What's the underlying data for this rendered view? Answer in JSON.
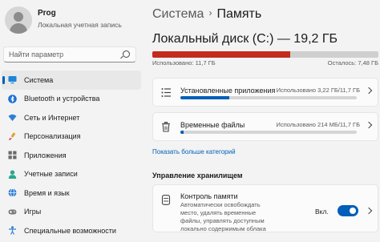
{
  "profile": {
    "name": "Prog",
    "account_type": "Локальная учетная запись"
  },
  "search": {
    "placeholder": "Найти параметр"
  },
  "sidebar": {
    "items": [
      {
        "label": "Система",
        "icon": "monitor-icon",
        "active": true
      },
      {
        "label": "Bluetooth и устройства",
        "icon": "bluetooth-icon"
      },
      {
        "label": "Сеть и Интернет",
        "icon": "wifi-icon"
      },
      {
        "label": "Персонализация",
        "icon": "brush-icon"
      },
      {
        "label": "Приложения",
        "icon": "apps-icon"
      },
      {
        "label": "Учетные записи",
        "icon": "person-icon"
      },
      {
        "label": "Время и язык",
        "icon": "globe-clock-icon"
      },
      {
        "label": "Игры",
        "icon": "gamepad-icon"
      },
      {
        "label": "Специальные возможности",
        "icon": "accessibility-icon"
      }
    ]
  },
  "header": {
    "root": "Система",
    "separator": "›",
    "current": "Память"
  },
  "disk": {
    "title": "Локальный диск (C:) — 19,2 ГБ",
    "used_label": "Использовано: 11,7 ГБ",
    "free_label": "Осталось: 7,48 ГБ",
    "used_fraction": 0.61,
    "bar_color": "#c42b1c"
  },
  "categories": [
    {
      "title": "Установленные приложения",
      "value": "Использовано 3,22 ГБ/11,7 ГБ",
      "fraction": 0.275,
      "icon": "list-icon"
    },
    {
      "title": "Временные файлы",
      "value": "Использовано 214 МБ/11,7 ГБ",
      "fraction": 0.018,
      "icon": "trash-icon"
    }
  ],
  "show_more": "Показать больше категорий",
  "storage_management": {
    "title": "Управление хранилищем",
    "sense": {
      "title": "Контроль памяти",
      "description": "Автоматически освобождать место, удалять временные файлы, управлять доступным локально содержимым облака",
      "toggle_label": "Вкл.",
      "enabled": true
    }
  },
  "accent_color": "#005fb8"
}
